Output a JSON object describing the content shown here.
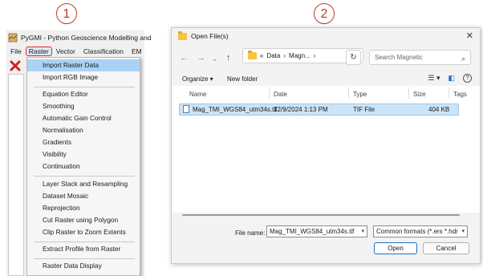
{
  "callouts": [
    "1",
    "2"
  ],
  "pygmi": {
    "title": "PyGMI - Python Geoscience Modelling and",
    "menu": [
      "File",
      "Raster",
      "Vector",
      "Classification",
      "EM"
    ],
    "active_menu": "Raster",
    "raster_menu": {
      "groups": [
        [
          "Import Raster Data",
          "Import RGB Image"
        ],
        [
          "Equation Editor",
          "Smoothing",
          "Automatic Gain Control",
          "Normalisation",
          "Gradients",
          "Visibility",
          "Continuation"
        ],
        [
          "Layer Stack and Resampling",
          "Dataset Mosaic",
          "Reprojection",
          "Cut Raster using Polygon",
          "Clip Raster to Zoom Extents"
        ],
        [
          "Extract Profile from Raster"
        ],
        [
          "Raster Data Display"
        ]
      ],
      "highlighted": "Import Raster Data"
    }
  },
  "dialog": {
    "title": "Open File(s)",
    "address": [
      "«",
      "Data",
      "›",
      "Magn...",
      "›"
    ],
    "search_placeholder": "Search Magnetic",
    "organize_label": "Organize ▾",
    "new_folder_label": "New folder",
    "columns": [
      "Name",
      "Date",
      "Type",
      "Size",
      "Tags"
    ],
    "files": [
      {
        "name": "Mag_TMI_WGS84_utm34s.tif",
        "date": "12/9/2024 1:13 PM",
        "type": "TIF File",
        "size": "404 KB",
        "selected": true
      }
    ],
    "file_name_label": "File name:",
    "file_name_value": "Mag_TMI_WGS84_utm34s.tif",
    "filter_value": "Common formats (*.ers *.hdr *.",
    "open_label": "Open",
    "cancel_label": "Cancel"
  },
  "colors": {
    "callout": "#c0392b",
    "highlight": "#aad2f4",
    "selected_row": "#cce4f7",
    "accent": "#1f6fc8"
  }
}
